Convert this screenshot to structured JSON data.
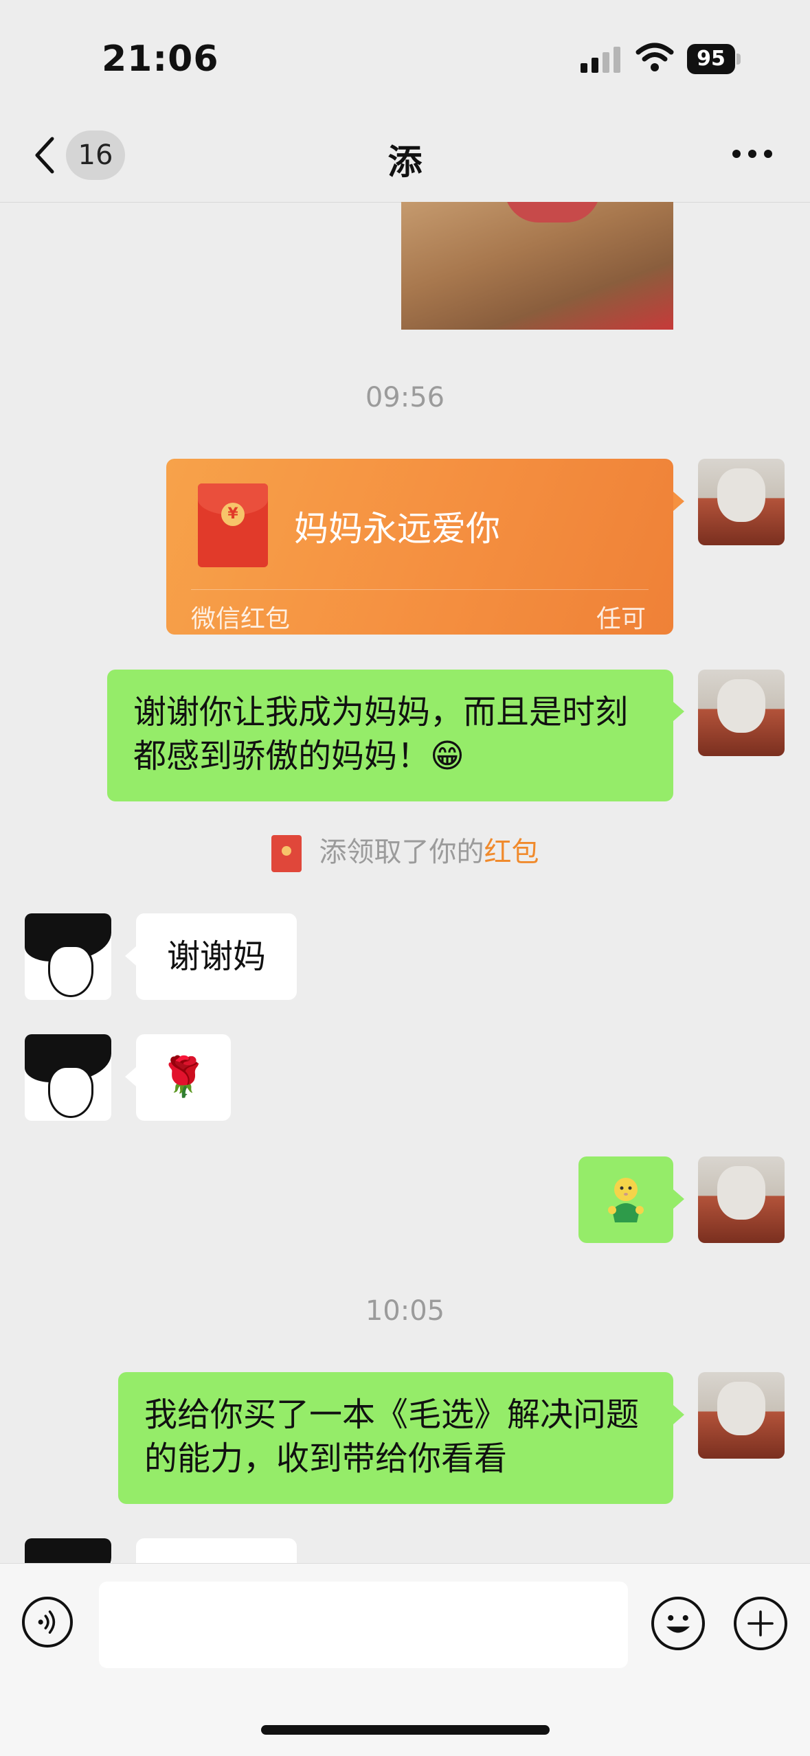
{
  "status_bar": {
    "time": "21:06",
    "battery": "95"
  },
  "nav": {
    "unread_count": "16",
    "title": "添"
  },
  "messages": {
    "timestamp_1": "09:56",
    "red_packet": {
      "greeting": "妈妈永远爱你",
      "label": "微信红包",
      "note": "任可"
    },
    "sent_text_1": "谢谢你让我成为妈妈，而且是时刻都感到骄傲的妈妈！😁",
    "system_notice": {
      "prefix": "添领取了你的",
      "link": "红包"
    },
    "received_text_1": "谢谢妈",
    "received_emoji_1": "🌹",
    "timestamp_2": "10:05",
    "sent_text_2": "我给你买了一本《毛选》解决问题的能力，收到带给你看看"
  },
  "colors": {
    "bubble_green": "#95ec69",
    "red_packet_orange": "#f59141",
    "link_orange": "#f08a2c"
  },
  "icons": [
    "back-chevron-icon",
    "more-dots-icon",
    "voice-icon",
    "emoji-icon",
    "plus-icon",
    "red-packet-icon"
  ]
}
